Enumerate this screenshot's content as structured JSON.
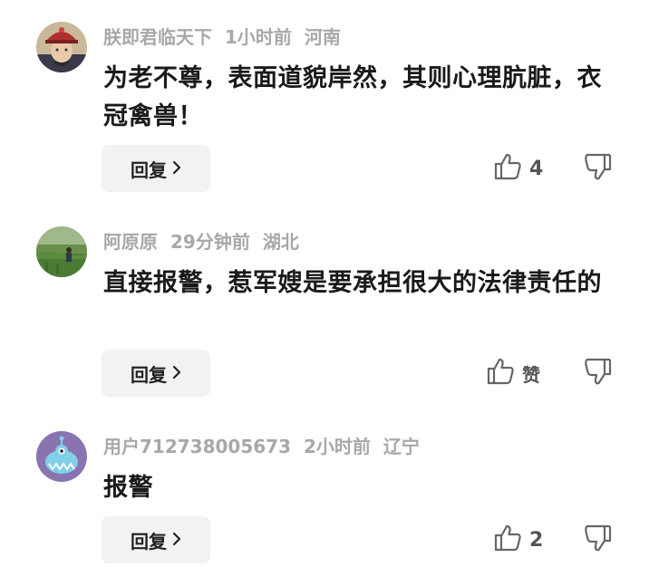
{
  "comments": [
    {
      "username": "朕即君临天下",
      "time": "1小时前",
      "location": "河南",
      "text": "为老不尊，表面道貌岸然，其则心理肮脏，衣冠禽兽！",
      "reply_label": "回复",
      "likes": "4",
      "avatar_icon": "qing-official-portrait-avatar"
    },
    {
      "username": "阿原原",
      "time": "29分钟前",
      "location": "湖北",
      "text": "直接报警，惹军嫂是要承担很大的法律责任的",
      "reply_label": "回复",
      "likes": "赞",
      "avatar_icon": "field-photo-avatar"
    },
    {
      "username": "用户712738005673",
      "time": "2小时前",
      "location": "辽宁",
      "text": "报警",
      "reply_label": "回复",
      "likes": "2",
      "avatar_icon": "blue-monster-avatar"
    }
  ],
  "colors": {
    "meta_text": "#a8a8a8",
    "body_text": "#1a1a1a",
    "reply_bg": "#f2f2f2",
    "icon_gray": "#666666"
  }
}
